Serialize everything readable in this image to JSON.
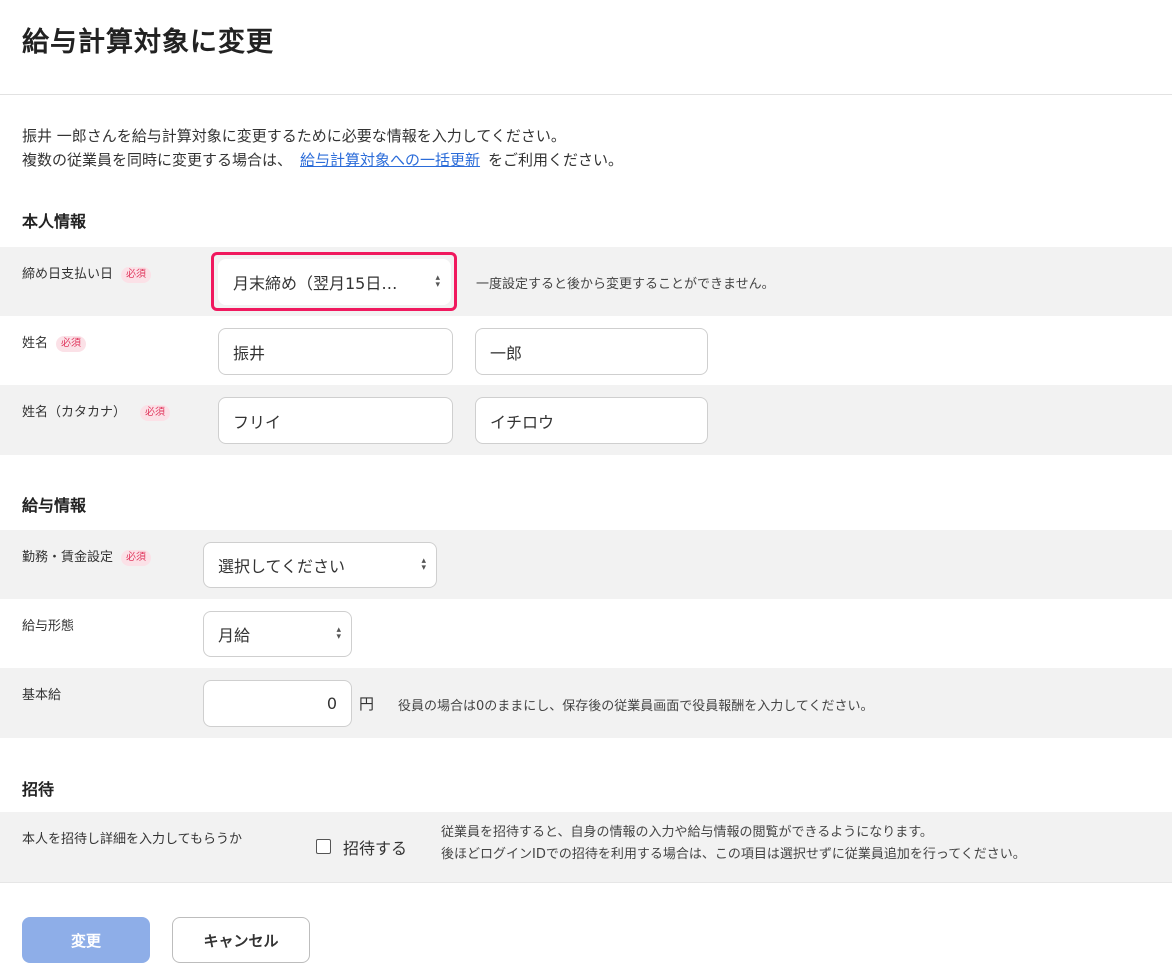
{
  "page": {
    "title": "給与計算対象に変更",
    "intro_line1": "振井 一郎さんを給与計算対象に変更するために必要な情報を入力してください。",
    "intro_line2_before": "複数の従業員を同時に変更する場合は、",
    "intro_link": "給与計算対象への一括更新",
    "intro_line2_after": "をご利用ください。"
  },
  "personal": {
    "section_title": "本人情報",
    "closing_label": "締め日支払い日",
    "closing_value": "月末締め（翌月15日…",
    "closing_note": "一度設定すると後から変更することができません。",
    "name_label": "姓名",
    "last_name": "振井",
    "first_name": "一郎",
    "kana_label": "姓名（カタカナ）",
    "last_name_kana": "フリイ",
    "first_name_kana": "イチロウ"
  },
  "payroll": {
    "section_title": "給与情報",
    "work_label": "勤務・賃金設定",
    "work_value": "選択してください",
    "pay_type_label": "給与形態",
    "pay_type_value": "月給",
    "base_label": "基本給",
    "base_value": "0",
    "base_unit": "円",
    "base_note": "役員の場合は0のままにし、保存後の従業員画面で役員報酬を入力してください。"
  },
  "invite": {
    "section_title": "招待",
    "label": "本人を招待し詳細を入力してもらうか",
    "checkbox_label": "招待する",
    "checked": false,
    "note_line1": "従業員を招待すると、自身の情報の入力や給与情報の閲覧ができるようになります。",
    "note_line2": "後ほどログインIDでの招待を利用する場合は、この項目は選択せずに従業員追加を行ってください。"
  },
  "badge_required": "必須",
  "actions": {
    "submit": "変更",
    "cancel": "キャンセル"
  },
  "colors": {
    "highlight": "#f0195e",
    "link": "#2b6cd9",
    "primary_button": "#8eaee8",
    "badge_text": "#e0385e"
  }
}
